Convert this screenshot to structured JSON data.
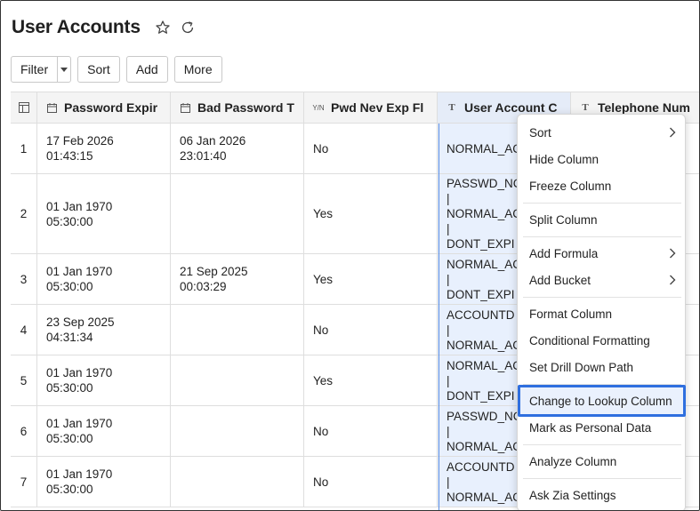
{
  "page": {
    "title": "User Accounts",
    "icons": {
      "favorite": "star-icon",
      "refresh": "refresh-icon"
    }
  },
  "toolbar": {
    "filter_label": "Filter",
    "sort_label": "Sort",
    "add_label": "Add",
    "more_label": "More"
  },
  "table": {
    "columns": [
      {
        "label": "Password Expir",
        "type_icon": "date-icon"
      },
      {
        "label": "Bad Password T",
        "type_icon": "date-icon"
      },
      {
        "label": "Pwd Nev Exp Fl",
        "type_icon": "Y/N"
      },
      {
        "label": "User Account C",
        "type_icon": "T"
      },
      {
        "label": "Telephone Num",
        "type_icon": "T"
      }
    ],
    "rows": [
      {
        "n": "1",
        "c1": [
          "17 Feb 2026",
          "01:43:15"
        ],
        "c2": [
          "06 Jan 2026",
          "23:01:40"
        ],
        "c3": "No",
        "c4": [
          "NORMAL_AC"
        ]
      },
      {
        "n": "2",
        "c1": [
          "01 Jan 1970",
          "05:30:00"
        ],
        "c2": [],
        "c3": "Yes",
        "c4": [
          "PASSWD_NC",
          "|",
          "NORMAL_AC",
          "|",
          "DONT_EXPI"
        ]
      },
      {
        "n": "3",
        "c1": [
          "01 Jan 1970",
          "05:30:00"
        ],
        "c2": [
          "21 Sep 2025",
          "00:03:29"
        ],
        "c3": "Yes",
        "c4": [
          "NORMAL_AC",
          "|",
          "DONT_EXPI"
        ]
      },
      {
        "n": "4",
        "c1": [
          "23 Sep 2025",
          "04:31:34"
        ],
        "c2": [],
        "c3": "No",
        "c4": [
          "ACCOUNTD",
          "|",
          "NORMAL_AC"
        ]
      },
      {
        "n": "5",
        "c1": [
          "01 Jan 1970",
          "05:30:00"
        ],
        "c2": [],
        "c3": "Yes",
        "c4": [
          "NORMAL_AC",
          "|",
          "DONT_EXPI"
        ]
      },
      {
        "n": "6",
        "c1": [
          "01 Jan 1970",
          "05:30:00"
        ],
        "c2": [],
        "c3": "No",
        "c4": [
          "PASSWD_NC",
          "|",
          "NORMAL_AC"
        ]
      },
      {
        "n": "7",
        "c1": [
          "01 Jan 1970",
          "05:30:00"
        ],
        "c2": [],
        "c3": "No",
        "c4": [
          "ACCOUNTD",
          "|",
          "NORMAL_AC"
        ]
      }
    ]
  },
  "context_menu": {
    "items": [
      {
        "label": "Sort",
        "submenu": true
      },
      {
        "label": "Hide Column"
      },
      {
        "label": "Freeze Column"
      },
      {
        "label": "Split Column"
      },
      {
        "label": "Add Formula",
        "submenu": true
      },
      {
        "label": "Add Bucket",
        "submenu": true
      },
      {
        "label": "Format Column"
      },
      {
        "label": "Conditional Formatting"
      },
      {
        "label": "Set Drill Down Path"
      },
      {
        "label": "Change to Lookup Column",
        "highlighted": true
      },
      {
        "label": "Mark as Personal Data"
      },
      {
        "label": "Analyze Column"
      },
      {
        "label": "Ask Zia Settings"
      }
    ]
  },
  "colors": {
    "accent": "#2f6fdf",
    "selected_column": "#e8f0fd"
  }
}
